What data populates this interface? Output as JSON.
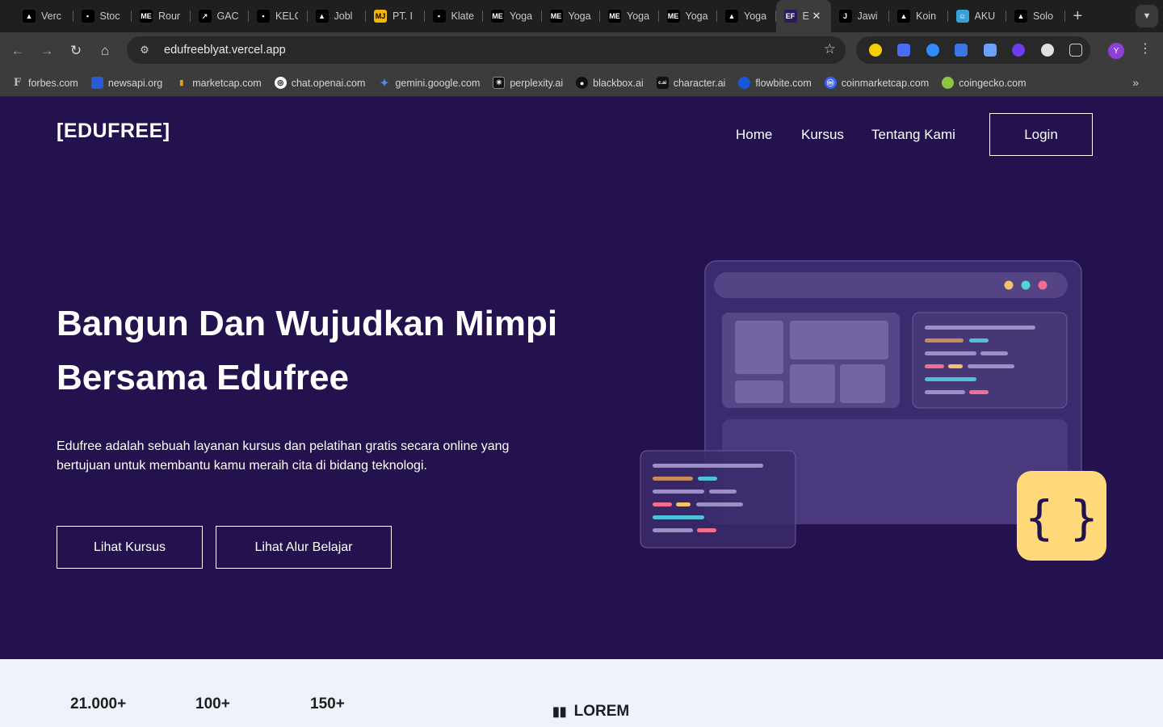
{
  "browser": {
    "tabs": [
      {
        "label": "Verc",
        "favicon": "triangle-icon",
        "color": "#000000"
      },
      {
        "label": "Stoc",
        "favicon": "square-dot-icon",
        "color": "#000000"
      },
      {
        "label": "Rour",
        "favicon": "me-icon",
        "color": "#000000"
      },
      {
        "label": "GAC",
        "favicon": "slash-icon",
        "color": "#000000"
      },
      {
        "label": "KELC",
        "favicon": "square-dot-icon",
        "color": "#000000"
      },
      {
        "label": "Jobl",
        "favicon": "triangle-icon",
        "color": "#000000"
      },
      {
        "label": "PT. I",
        "favicon": "mj-icon",
        "color": "#f4b400"
      },
      {
        "label": "Klate",
        "favicon": "square-dot-icon",
        "color": "#000000"
      },
      {
        "label": "Yoga",
        "favicon": "me-icon",
        "color": "#000000"
      },
      {
        "label": "Yoga",
        "favicon": "me-icon",
        "color": "#000000"
      },
      {
        "label": "Yoga",
        "favicon": "me-icon",
        "color": "#000000"
      },
      {
        "label": "Yoga",
        "favicon": "me-icon",
        "color": "#000000"
      },
      {
        "label": "Yoga",
        "favicon": "triangle-icon",
        "color": "#000000"
      },
      {
        "label": "E",
        "favicon": "ef-icon",
        "color": "#2b1a5e",
        "active": true
      },
      {
        "label": "Jawi",
        "favicon": "j-icon",
        "color": "#000000"
      },
      {
        "label": "Koin",
        "favicon": "triangle-icon",
        "color": "#000000"
      },
      {
        "label": "AKU",
        "favicon": "cartoon-icon",
        "color": "#3aa0d8"
      },
      {
        "label": "Solo",
        "favicon": "triangle-icon",
        "color": "#000000"
      }
    ],
    "url": "edufreeblyat.vercel.app",
    "profile_initial": "Y",
    "bookmarks": [
      {
        "label": "forbes.com",
        "color": "#111111",
        "glyph": "F"
      },
      {
        "label": "newsapi.org",
        "color": "#2a5bd7",
        "glyph": ""
      },
      {
        "label": "marketcap.com",
        "color": "#f4a000",
        "glyph": ""
      },
      {
        "label": "chat.openai.com",
        "color": "#ffffff",
        "glyph": ""
      },
      {
        "label": "gemini.google.com",
        "color": "#4c8bf5",
        "glyph": ""
      },
      {
        "label": "perplexity.ai",
        "color": "#111111",
        "glyph": ""
      },
      {
        "label": "blackbox.ai",
        "color": "#111111",
        "glyph": ""
      },
      {
        "label": "character.ai",
        "color": "#111111",
        "glyph": "c.ai"
      },
      {
        "label": "flowbite.com",
        "color": "#1a56db",
        "glyph": ""
      },
      {
        "label": "coinmarketcap.com",
        "color": "#3861fb",
        "glyph": ""
      },
      {
        "label": "coingecko.com",
        "color": "#8dc63f",
        "glyph": ""
      }
    ],
    "extensions": [
      "#f5d000",
      "#4a6cf7",
      "#2f8cff",
      "#3b78e7",
      "#6aa0ff",
      "#6b3cf0",
      "#e0e0e0",
      "#bdbdbd"
    ]
  },
  "site": {
    "logo": "[EDUFREE]",
    "nav": [
      "Home",
      "Kursus",
      "Tentang Kami"
    ],
    "login": "Login",
    "hero_title": "Bangun Dan Wujudkan Mimpi Bersama Edufree",
    "hero_text": "Edufree adalah sebuah layanan kursus dan pelatihan gratis secara online yang bertujuan untuk membantu kamu meraih cita di bidang teknologi.",
    "btn_courses": "Lihat Kursus",
    "btn_path": "Lihat Alur Belajar",
    "code_badge": "{ }",
    "stats": [
      "21.000+",
      "100+",
      "150+"
    ],
    "lorem": "LOREM",
    "colors": {
      "bg": "#23124e",
      "stats_bg": "#edf2fb",
      "badge": "#ffd97a"
    }
  }
}
